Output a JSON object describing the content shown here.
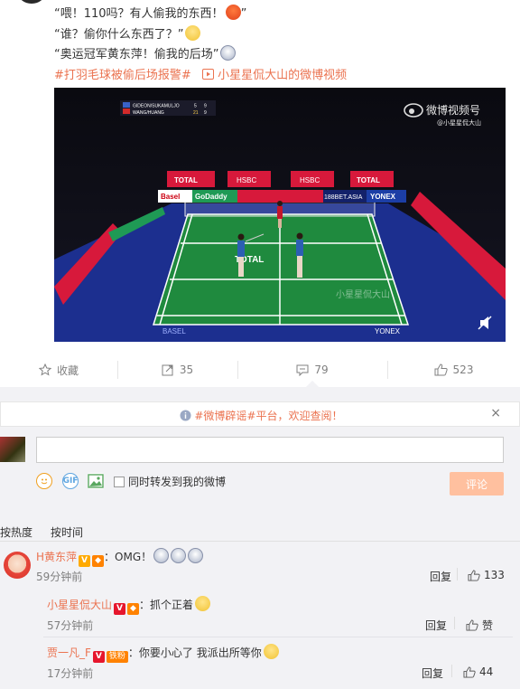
{
  "post": {
    "line1": "“喂！110吗？有人偷我的东西！",
    "line1_end": "”",
    "line2": "“谁？偷你什么东西了？”",
    "line3": "“奥运冠军黄东萍！偷我的后场”",
    "hashtag": "#打羽毛球被偷后场报警#",
    "video_link": "小星星侃大山的微博视频"
  },
  "video": {
    "watermark_brand": "微博视频号",
    "watermark_user": "@小星星侃大山",
    "corner_text": "小星星侃大山",
    "score_p1": "GIDEON/SUKAMULJO",
    "score_p2": "WANG/HUANG",
    "score_p1_g": "5",
    "score_p1_s": "9",
    "score_p2_g": "21",
    "score_p2_s": "9",
    "court_text": "TOTAL",
    "ad_total": "TOTAL",
    "ad_hsbc": "HSBC",
    "ad_basel": "Basel",
    "ad_godaddy": "GoDaddy",
    "ad_bet": "188BET.ASIA",
    "ad_yonex": "YONEX",
    "ad_basel_floor": "BASEL",
    "ad_yonex_floor": "YONEX",
    "icons": [
      "weibo-logo-icon",
      "volume-mute-icon"
    ]
  },
  "actions": {
    "favorite": "收藏",
    "repost": "35",
    "comment": "79",
    "like": "523"
  },
  "notice": {
    "text": "#微博辟谣#平台，欢迎查阅！",
    "close": "×"
  },
  "composer": {
    "repost_check_label": "同时转发到我的微博",
    "submit": "评论",
    "gif": "GIF"
  },
  "sort": {
    "hot": "按热度",
    "time": "按时间"
  },
  "comments": [
    {
      "user": "H黄东萍",
      "text": "：OMG！",
      "time": "59分钟前",
      "reply": "回复",
      "likes": "133"
    }
  ],
  "sub_comments": [
    {
      "user": "小星星侃大山",
      "text": "：抓个正着",
      "time": "57分钟前",
      "reply": "回复",
      "likes": "赞"
    },
    {
      "user": "贾一凡_F",
      "fan_badge": "铁粉",
      "text": "：你要小心了 我派出所等你",
      "time": "17分钟前",
      "reply": "回复",
      "likes": "44"
    }
  ],
  "colors": {
    "accent": "#eb7350",
    "muted": "#808080",
    "court_green": "#1f8a3e",
    "court_blue": "#1c2f8f",
    "submit_disabled": "#ffc09f"
  }
}
